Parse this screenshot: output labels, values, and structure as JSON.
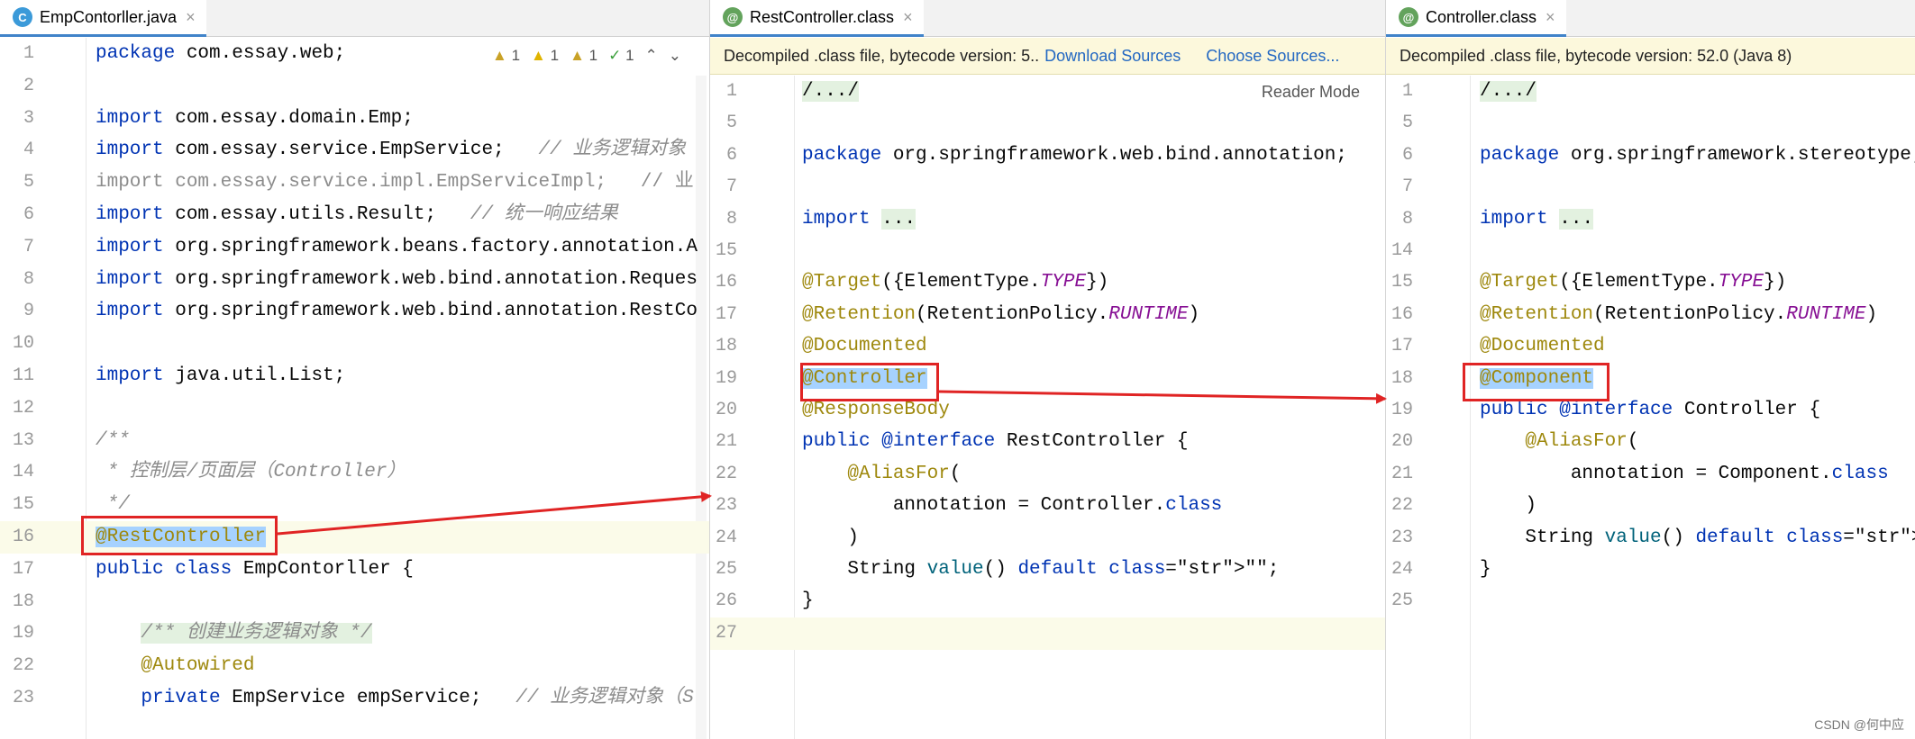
{
  "panes": [
    {
      "tab": "EmpContorller.java",
      "tab_icon": "C",
      "inspections": [
        "1",
        "1",
        "1",
        "1"
      ],
      "lines": [
        {
          "n": "1",
          "text": "package com.essay.web;"
        },
        {
          "n": "2",
          "text": ""
        },
        {
          "n": "3",
          "text": "import com.essay.domain.Emp;"
        },
        {
          "n": "4",
          "text": "import com.essay.service.EmpService;   // 业务逻辑对象"
        },
        {
          "n": "5",
          "text": "import com.essay.service.impl.EmpServiceImpl;   // 业"
        },
        {
          "n": "6",
          "text": "import com.essay.utils.Result;   // 统一响应结果"
        },
        {
          "n": "7",
          "text": "import org.springframework.beans.factory.annotation.A"
        },
        {
          "n": "8",
          "text": "import org.springframework.web.bind.annotation.Reques"
        },
        {
          "n": "9",
          "text": "import org.springframework.web.bind.annotation.RestCo"
        },
        {
          "n": "10",
          "text": ""
        },
        {
          "n": "11",
          "text": "import java.util.List;"
        },
        {
          "n": "12",
          "text": ""
        },
        {
          "n": "13",
          "text": "/**"
        },
        {
          "n": "14",
          "text": " * 控制层/页面层（Controller）"
        },
        {
          "n": "15",
          "text": " */"
        },
        {
          "n": "16",
          "text": "@RestController"
        },
        {
          "n": "17",
          "text": "public class EmpContorller {"
        },
        {
          "n": "18",
          "text": ""
        },
        {
          "n": "19",
          "text": "    /** 创建业务逻辑对象 */"
        },
        {
          "n": "22",
          "text": "    @Autowired"
        },
        {
          "n": "23",
          "text": "    private EmpService empService;   // 业务逻辑对象（S"
        }
      ]
    },
    {
      "tab": "RestController.class",
      "tab_icon": "@",
      "banner": "Decompiled .class file, bytecode version: 5..",
      "download_sources": "Download Sources",
      "choose_sources": "Choose Sources...",
      "reader_mode": "Reader Mode",
      "lines": [
        {
          "n": "1",
          "text": "/.../"
        },
        {
          "n": "5",
          "text": ""
        },
        {
          "n": "6",
          "text": "package org.springframework.web.bind.annotation;"
        },
        {
          "n": "7",
          "text": ""
        },
        {
          "n": "8",
          "text": "import ..."
        },
        {
          "n": "15",
          "text": ""
        },
        {
          "n": "16",
          "text": "@Target({ElementType.TYPE})"
        },
        {
          "n": "17",
          "text": "@Retention(RetentionPolicy.RUNTIME)"
        },
        {
          "n": "18",
          "text": "@Documented"
        },
        {
          "n": "19",
          "text": "@Controller"
        },
        {
          "n": "20",
          "text": "@ResponseBody"
        },
        {
          "n": "21",
          "text": "public @interface RestController {"
        },
        {
          "n": "22",
          "text": "    @AliasFor("
        },
        {
          "n": "23",
          "text": "        annotation = Controller.class"
        },
        {
          "n": "24",
          "text": "    )"
        },
        {
          "n": "25",
          "text": "    String value() default \"\";"
        },
        {
          "n": "26",
          "text": "}"
        },
        {
          "n": "27",
          "text": ""
        }
      ]
    },
    {
      "tab": "Controller.class",
      "tab_icon": "@",
      "banner": "Decompiled .class file, bytecode version: 52.0 (Java 8)",
      "lines": [
        {
          "n": "1",
          "text": "/.../"
        },
        {
          "n": "5",
          "text": ""
        },
        {
          "n": "6",
          "text": "package org.springframework.stereotype;"
        },
        {
          "n": "7",
          "text": ""
        },
        {
          "n": "8",
          "text": "import ..."
        },
        {
          "n": "14",
          "text": ""
        },
        {
          "n": "15",
          "text": "@Target({ElementType.TYPE})"
        },
        {
          "n": "16",
          "text": "@Retention(RetentionPolicy.RUNTIME)"
        },
        {
          "n": "17",
          "text": "@Documented"
        },
        {
          "n": "18",
          "text": "@Component"
        },
        {
          "n": "19",
          "text": "public @interface Controller {"
        },
        {
          "n": "20",
          "text": "    @AliasFor("
        },
        {
          "n": "21",
          "text": "        annotation = Component.class"
        },
        {
          "n": "22",
          "text": "    )"
        },
        {
          "n": "23",
          "text": "    String value() default \"\";"
        },
        {
          "n": "24",
          "text": "}"
        },
        {
          "n": "25",
          "text": ""
        }
      ]
    }
  ],
  "watermark": "CSDN @何中应",
  "colors": {
    "highlight_box": "#e02424",
    "arrow": "#e02424",
    "tab_underline": "#4083c9",
    "banner_bg": "#fcf8dc"
  }
}
